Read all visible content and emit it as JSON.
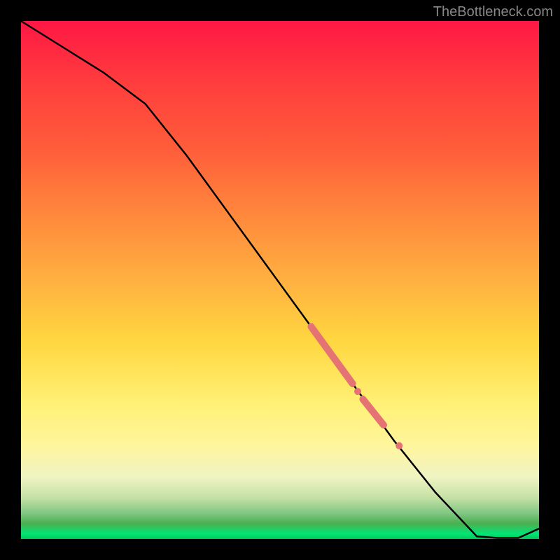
{
  "watermark": "TheBottleneck.com",
  "chart_data": {
    "type": "line",
    "title": "",
    "xlabel": "",
    "ylabel": "",
    "xlim": [
      0,
      100
    ],
    "ylim": [
      0,
      100
    ],
    "series": [
      {
        "name": "curve",
        "x": [
          0,
          8,
          16,
          24,
          32,
          40,
          48,
          56,
          64,
          72,
          80,
          88,
          92,
          96,
          100
        ],
        "y": [
          100,
          95,
          90,
          84,
          74,
          63,
          52,
          41,
          30,
          19,
          9,
          0.5,
          0.2,
          0.2,
          2
        ]
      }
    ],
    "highlight_segments": [
      {
        "x0": 56,
        "y0": 41,
        "x1": 64,
        "y1": 30
      },
      {
        "x0": 66,
        "y0": 27,
        "x1": 70,
        "y1": 22
      }
    ],
    "highlight_points": [
      {
        "x": 65,
        "y": 28.5
      },
      {
        "x": 73,
        "y": 18
      }
    ]
  }
}
